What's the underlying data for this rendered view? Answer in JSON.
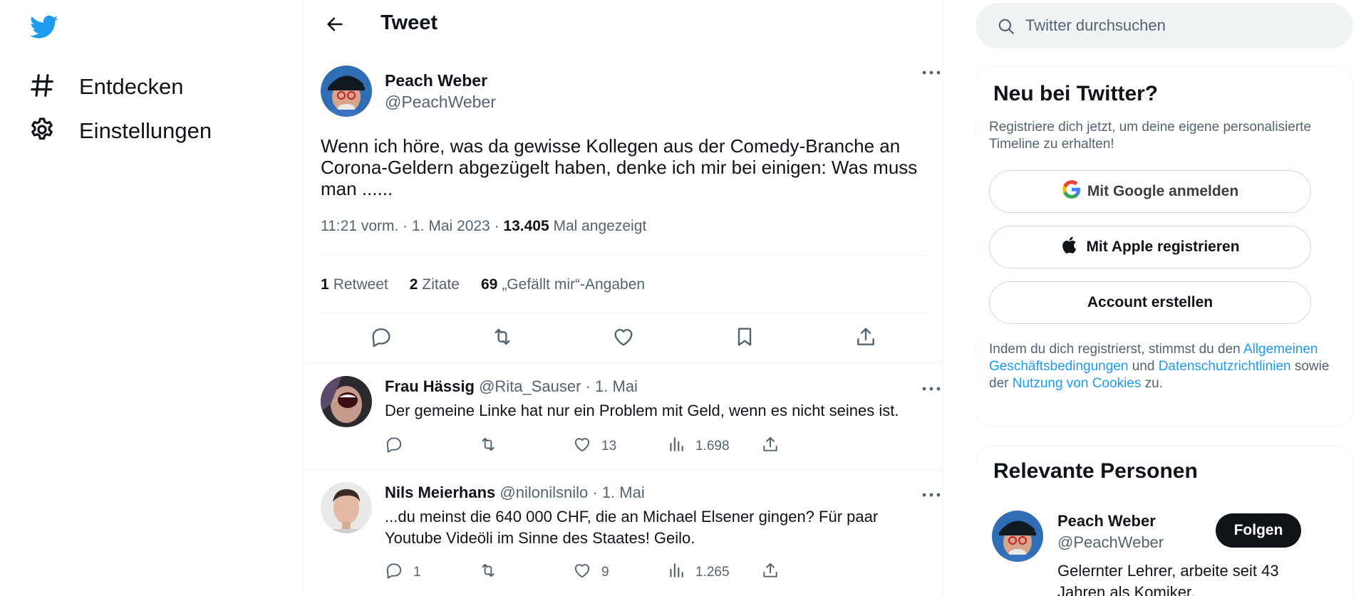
{
  "nav": {
    "items": [
      {
        "label": "Entdecken",
        "icon": "hashtag-icon"
      },
      {
        "label": "Einstellungen",
        "icon": "gear-icon"
      }
    ]
  },
  "header": {
    "title": "Tweet"
  },
  "tweet": {
    "author_name": "Peach Weber",
    "author_handle": "@PeachWeber",
    "text": "Wenn ich höre, was da gewisse Kollegen aus der Comedy-Branche an Corona-Geldern abgezügelt haben, denke ich mir bei einigen: Was muss man ......",
    "time": "11:21 vorm. · 1. Mai 2023 · ",
    "views_count": "13.405",
    "views_label": " Mal angezeigt",
    "retweets_count": "1",
    "retweets_label": "Retweet",
    "quotes_count": "2",
    "quotes_label": "Zitate",
    "likes_count": "69",
    "likes_label": "„Gefällt mir“-Angaben"
  },
  "replies": [
    {
      "name": "Frau Hässig",
      "handle": "@Rita_Sauser",
      "dot": " · ",
      "date": "1. Mai",
      "text": "Der gemeine Linke hat nur ein Problem mit Geld, wenn es nicht seines ist.",
      "reply_count": "",
      "retweet_count": "",
      "like_count": "13",
      "view_count": "1.698"
    },
    {
      "name": "Nils Meierhans",
      "handle": "@nilonilsnilo",
      "dot": " · ",
      "date": "1. Mai",
      "text": "...du meinst die 640 000 CHF, die an Michael Elsener gingen? Für paar Youtube Videöli im Sinne des Staates! Geilo.",
      "reply_count": "1",
      "retweet_count": "",
      "like_count": "9",
      "view_count": "1.265"
    }
  ],
  "search": {
    "placeholder": "Twitter durchsuchen"
  },
  "signup": {
    "title": "Neu bei Twitter?",
    "subtitle": "Registriere dich jetzt, um deine eigene personalisierte Timeline zu erhalten!",
    "google_label": "Mit Google anmelden",
    "apple_label": "Mit Apple registrieren",
    "create_label": "Account erstellen",
    "legal_prefix": "Indem du dich registrierst, stimmst du den ",
    "legal_terms": "Allgemeinen Geschäftsbedingungen",
    "legal_and": " und ",
    "legal_privacy": "Datenschutzrichtlinien",
    "legal_as": " sowie der ",
    "legal_cookies": "Nutzung von Cookies",
    "legal_suffix": " zu."
  },
  "relevant": {
    "title": "Relevante Personen",
    "name": "Peach Weber",
    "handle": "@PeachWeber",
    "follow_label": "Folgen",
    "bio": "Gelernter Lehrer, arbeite seit 43 Jahren als Komiker."
  },
  "colors": {
    "brand": "#1d9bf0",
    "text": "#0f1419",
    "secondary": "#536471",
    "border": "#eff3f4"
  }
}
